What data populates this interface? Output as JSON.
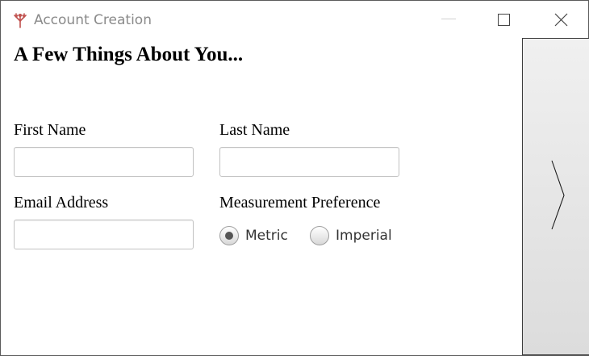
{
  "window": {
    "title": "Account Creation",
    "icon": "app-logo-icon",
    "controls": [
      "minimize-icon",
      "maximize-icon",
      "close-icon"
    ]
  },
  "page": {
    "heading": "A Few Things About You..."
  },
  "form": {
    "first_name": {
      "label": "First Name",
      "value": "",
      "placeholder": ""
    },
    "last_name": {
      "label": "Last Name",
      "value": "",
      "placeholder": ""
    },
    "email": {
      "label": "Email Address",
      "value": "",
      "placeholder": ""
    },
    "measurement": {
      "label": "Measurement Preference",
      "options": [
        {
          "label": "Metric",
          "selected": true
        },
        {
          "label": "Imperial",
          "selected": false
        }
      ]
    }
  },
  "navigation": {
    "next_icon": "chevron-right-icon"
  },
  "colors": {
    "accent_icon": "#c0504d",
    "title_text": "#8a8a8a",
    "radio_selected_dot": "#555555",
    "panel_gradient_top": "#f0f0f0",
    "panel_gradient_bottom": "#dcdcdc"
  }
}
